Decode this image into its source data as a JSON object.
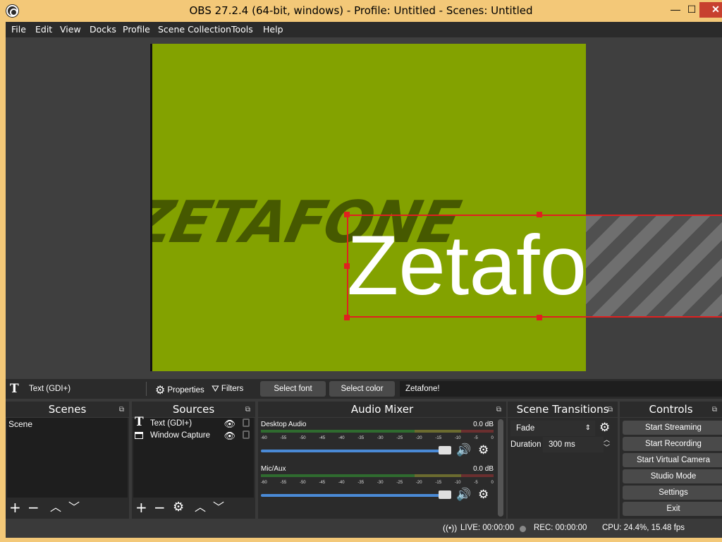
{
  "window": {
    "title": "OBS 27.2.4 (64-bit, windows) - Profile: Untitled - Scenes: Untitled",
    "min_glyph": "—",
    "max_glyph": "☐",
    "close_glyph": "✕"
  },
  "menu": [
    "File",
    "Edit",
    "View",
    "Docks",
    "Profile",
    "Scene Collection",
    "Tools",
    "Help"
  ],
  "preview": {
    "background_logo": "ZETAFONE",
    "text_source": "Zetafone!",
    "canvas_color": "#83a200",
    "selection_color": "#e02020"
  },
  "source_toolbar": {
    "source_name": "Text (GDI+)",
    "properties": "Properties",
    "filters": "Filters",
    "select_font": "Select font",
    "select_color": "Select color",
    "text_value": "Zetafone!"
  },
  "docks": {
    "scenes": {
      "title": "Scenes",
      "items": [
        "Scene"
      ]
    },
    "sources": {
      "title": "Sources",
      "items": [
        {
          "name": "Text (GDI+)",
          "icon": "text-icon"
        },
        {
          "name": "Window Capture",
          "icon": "window-icon"
        }
      ]
    },
    "mixer": {
      "title": "Audio Mixer",
      "channels": [
        {
          "name": "Desktop Audio",
          "level": "0.0 dB",
          "volume_fraction": 1.0
        },
        {
          "name": "Mic/Aux",
          "level": "0.0 dB",
          "volume_fraction": 1.0
        }
      ],
      "ticks": [
        "-60",
        "-55",
        "-50",
        "-45",
        "-40",
        "-35",
        "-30",
        "-25",
        "-20",
        "-15",
        "-10",
        "-5",
        "0"
      ]
    },
    "transitions": {
      "title": "Scene Transitions",
      "selected": "Fade",
      "duration_label": "Duration",
      "duration_value": "300 ms"
    },
    "controls": {
      "title": "Controls",
      "buttons": [
        "Start Streaming",
        "Start Recording",
        "Start Virtual Camera",
        "Studio Mode",
        "Settings",
        "Exit"
      ]
    }
  },
  "status": {
    "live": "LIVE: 00:00:00",
    "rec": "REC: 00:00:00",
    "cpu": "CPU: 24.4%, 15.48 fps"
  }
}
